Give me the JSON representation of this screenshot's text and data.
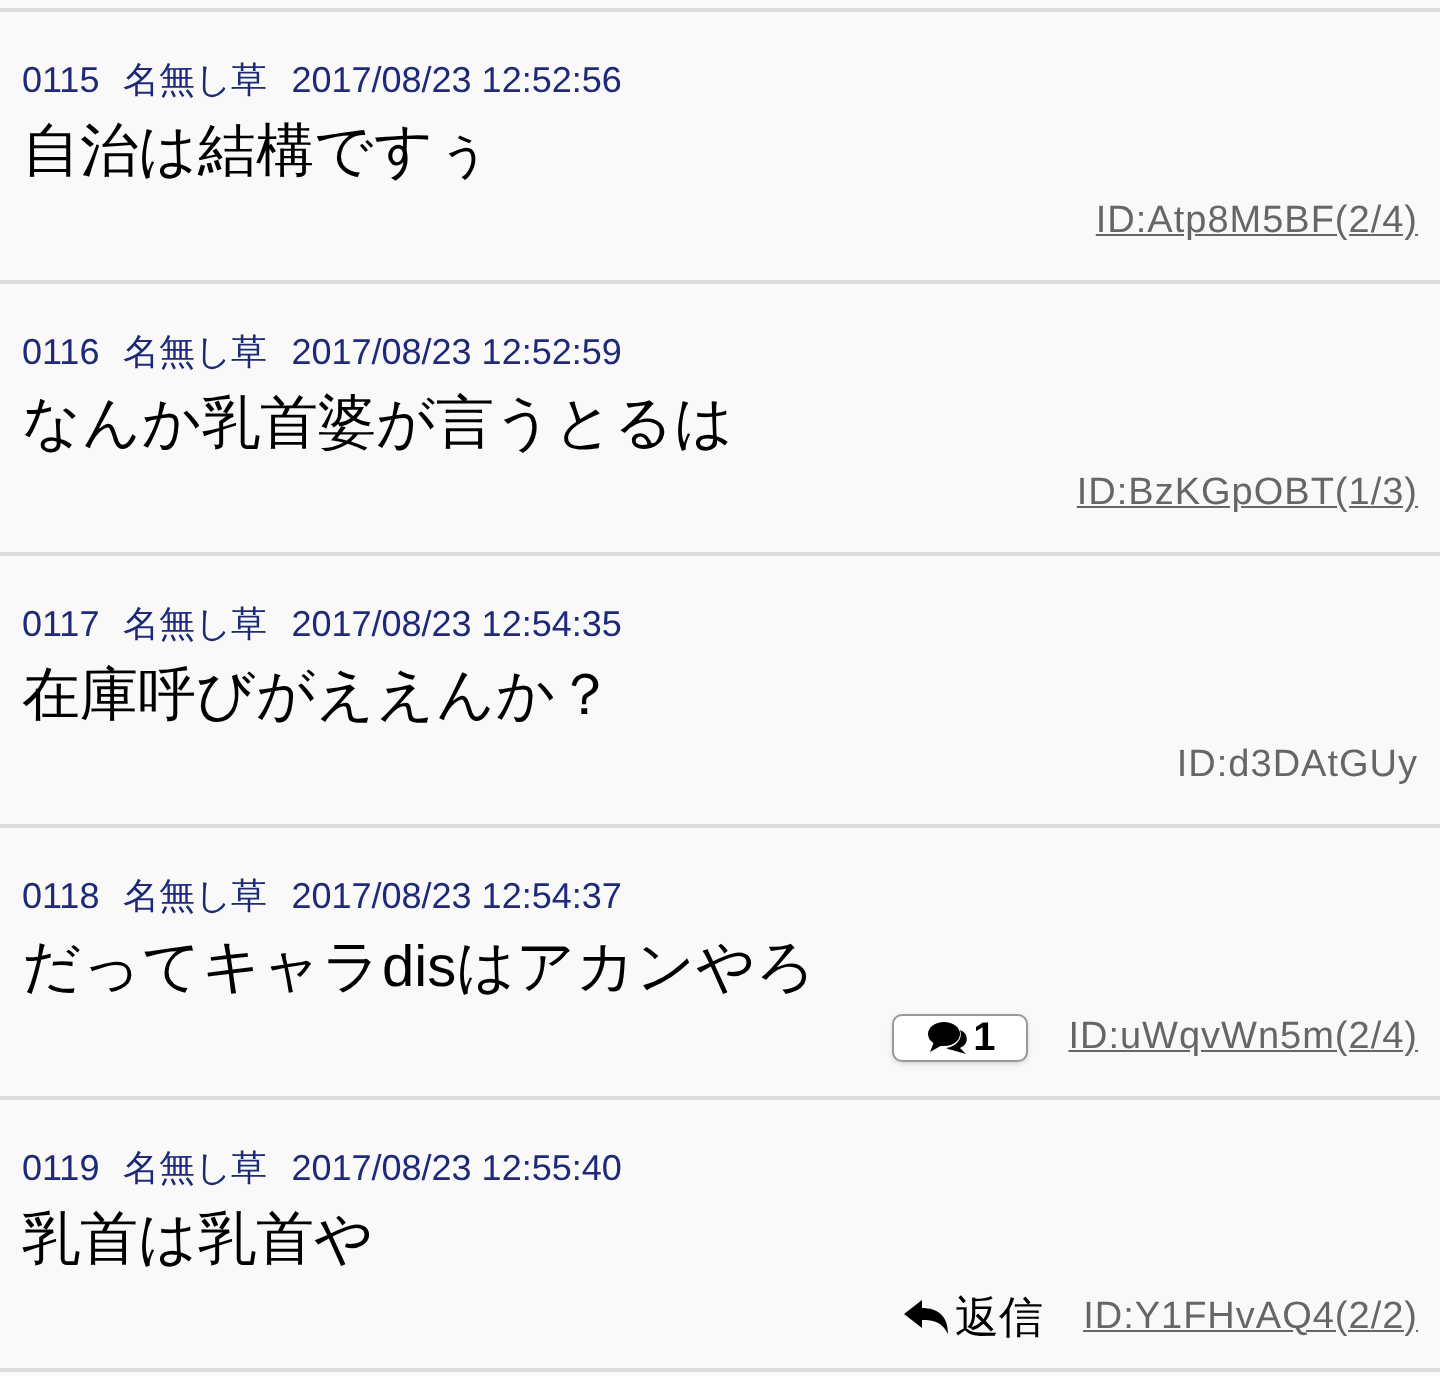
{
  "posts": [
    {
      "number": "0115",
      "author": "名無し草",
      "date": "2017/08/23 12:52:56",
      "body": "自治は結構ですぅ",
      "id": "ID:Atp8M5BF(2/4)",
      "linked": true
    },
    {
      "number": "0116",
      "author": "名無し草",
      "date": "2017/08/23 12:52:59",
      "body": "なんか乳首婆が言うとるは",
      "id": "ID:BzKGpOBT(1/3)",
      "linked": true
    },
    {
      "number": "0117",
      "author": "名無し草",
      "date": "2017/08/23 12:54:35",
      "body": "在庫呼びがええんか？",
      "id": "ID:d3DAtGUy",
      "linked": false
    },
    {
      "number": "0118",
      "author": "名無し草",
      "date": "2017/08/23 12:54:37",
      "body": "だってキャラdisはアカンやろ",
      "id": "ID:uWqvWn5m(2/4)",
      "linked": true,
      "action": {
        "kind": "replies",
        "label": "1"
      }
    },
    {
      "number": "0119",
      "author": "名無し草",
      "date": "2017/08/23 12:55:40",
      "body": "乳首は乳首や",
      "id": "ID:Y1FHvAQ4(2/2)",
      "linked": true,
      "action": {
        "kind": "reply",
        "label": "返信"
      }
    }
  ]
}
